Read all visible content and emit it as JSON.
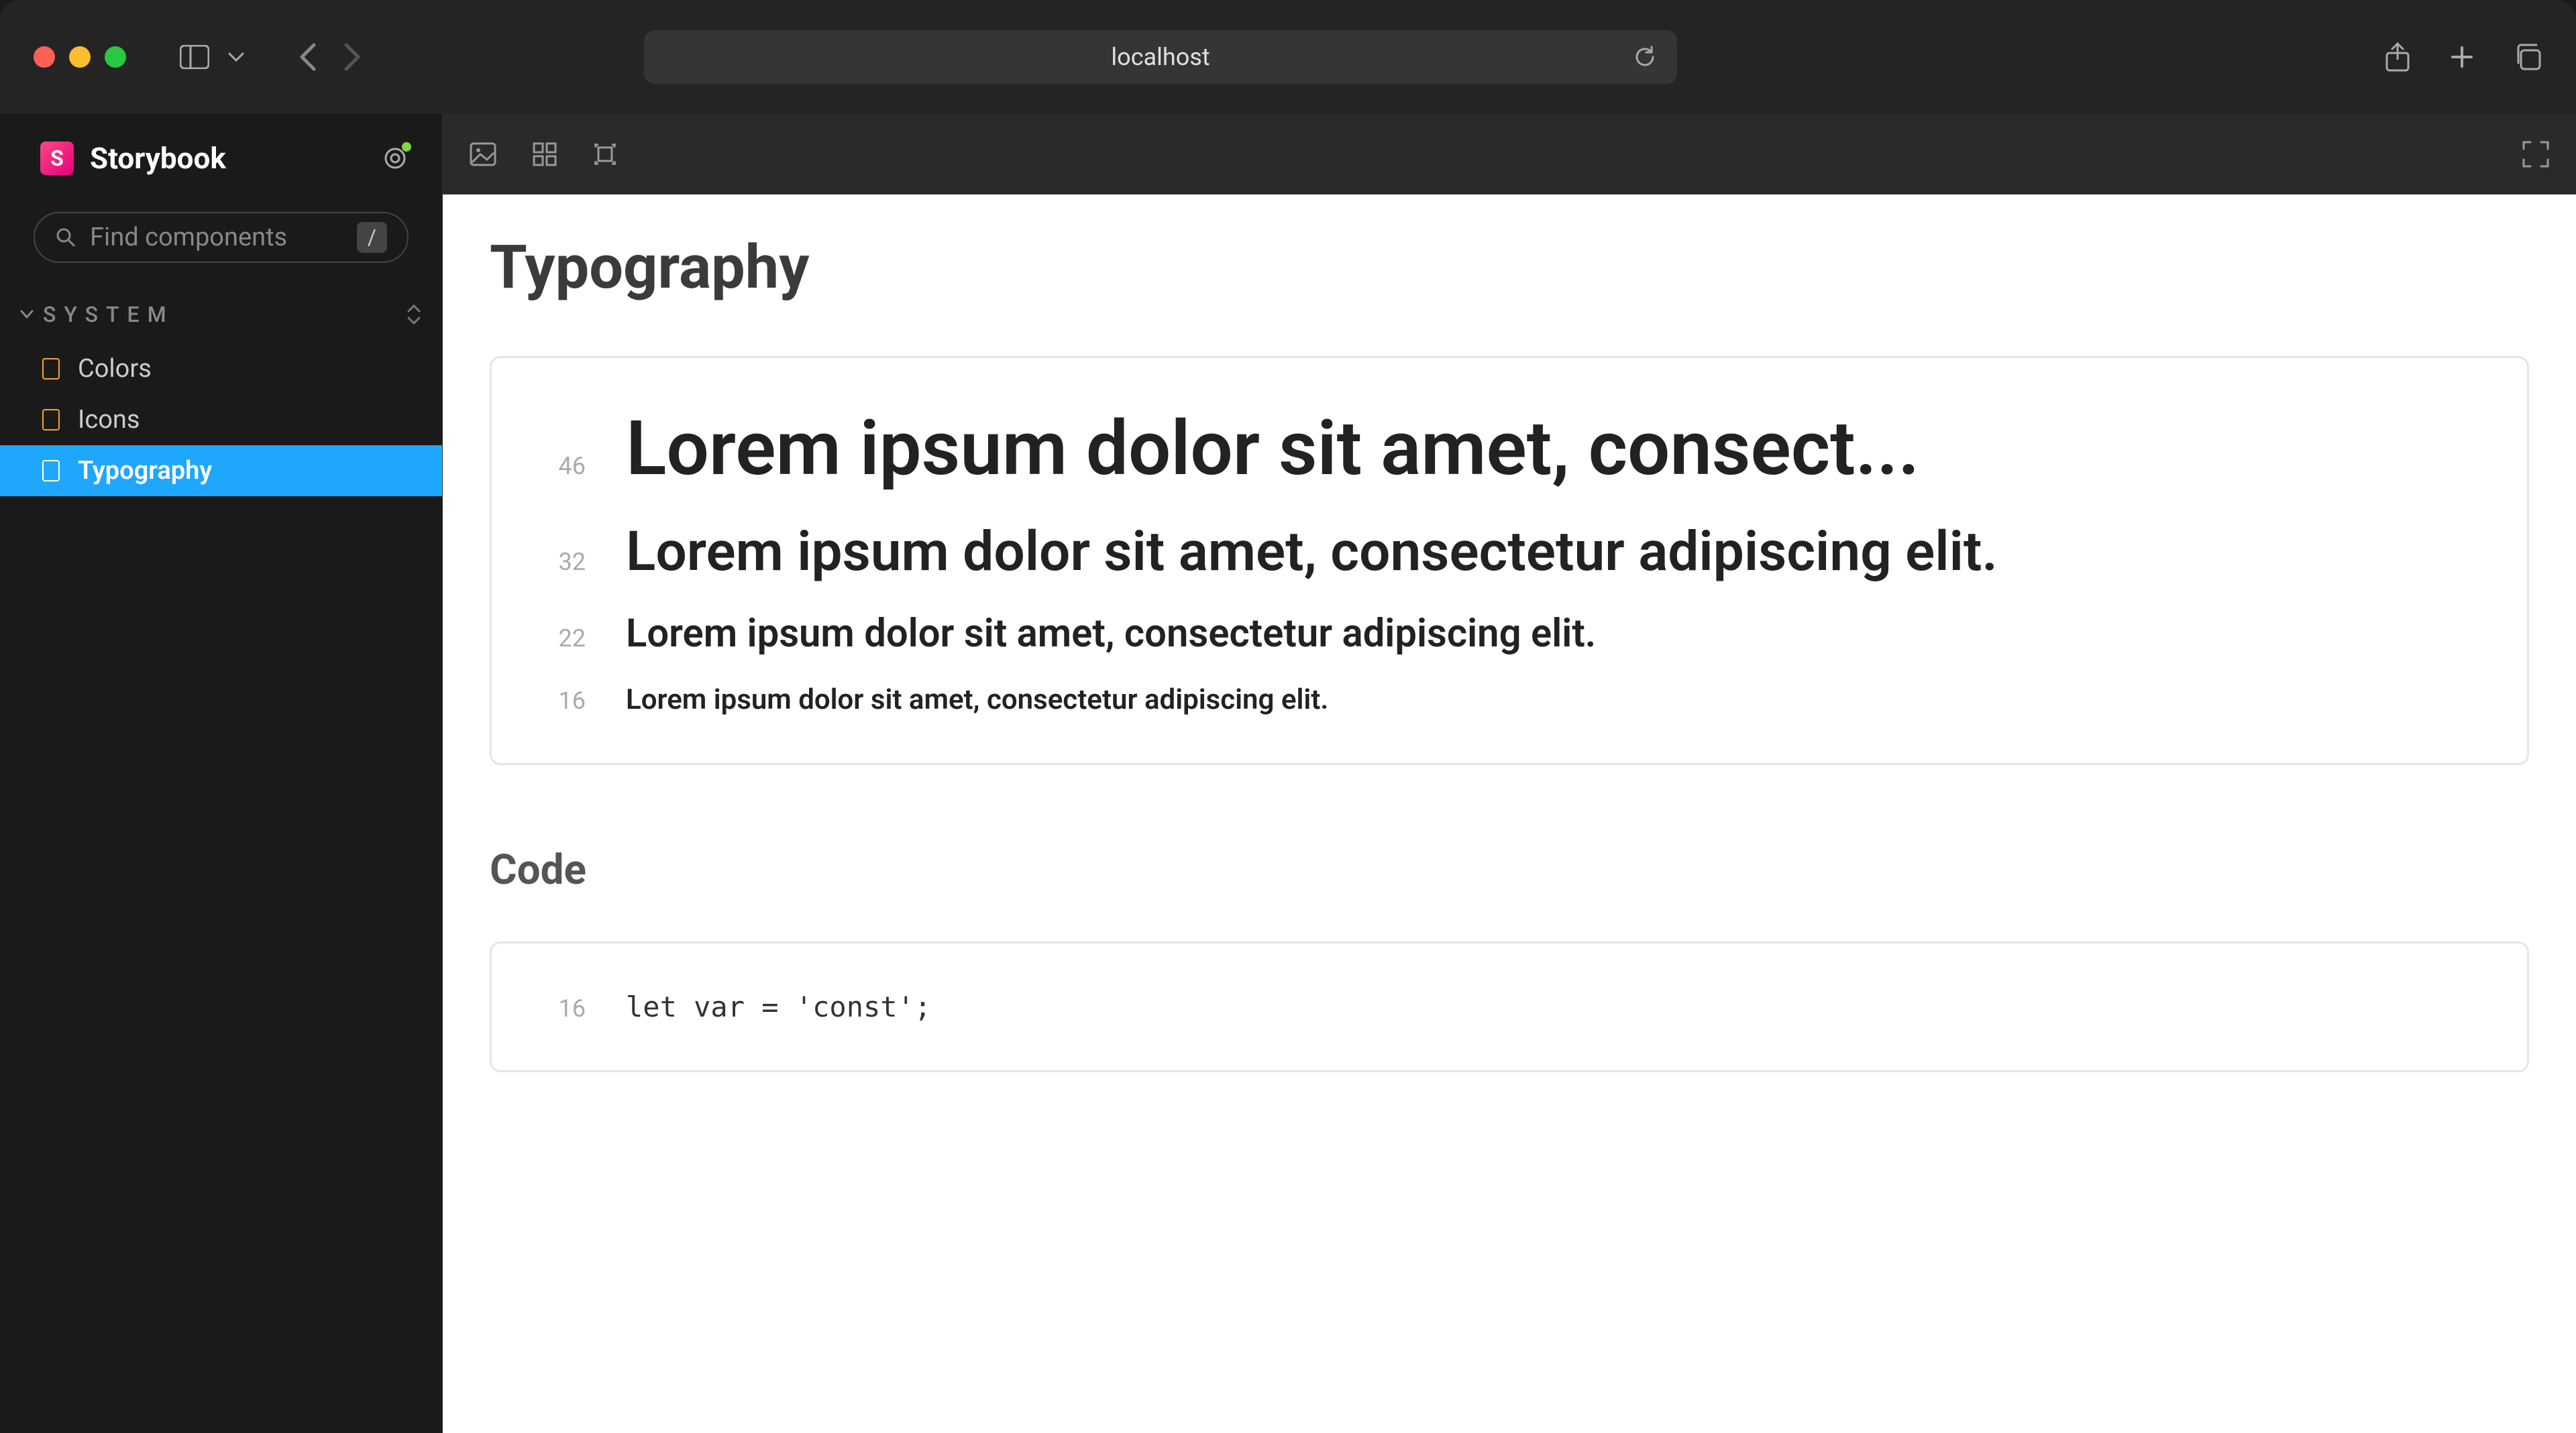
{
  "browser": {
    "url": "localhost"
  },
  "app": {
    "name": "Storybook",
    "logo_letter": "S"
  },
  "search": {
    "placeholder": "Find components",
    "shortcut": "/"
  },
  "section": {
    "title": "SYSTEM"
  },
  "nav": {
    "items": [
      {
        "label": "Colors",
        "active": false
      },
      {
        "label": "Icons",
        "active": false
      },
      {
        "label": "Typography",
        "active": true
      }
    ]
  },
  "page": {
    "title": "Typography",
    "type_samples": [
      {
        "size": "46",
        "text": "Lorem ipsum dolor sit amet, consect...",
        "class": "ts-46"
      },
      {
        "size": "32",
        "text": "Lorem ipsum dolor sit amet, consectetur adipiscing elit.",
        "class": "ts-32"
      },
      {
        "size": "22",
        "text": "Lorem ipsum dolor sit amet, consectetur adipiscing elit.",
        "class": "ts-22"
      },
      {
        "size": "16",
        "text": "Lorem ipsum dolor sit amet, consectetur adipiscing elit.",
        "class": "ts-16"
      }
    ],
    "code_heading": "Code",
    "code_samples": [
      {
        "size": "16",
        "text": "let var = 'const';"
      }
    ]
  }
}
